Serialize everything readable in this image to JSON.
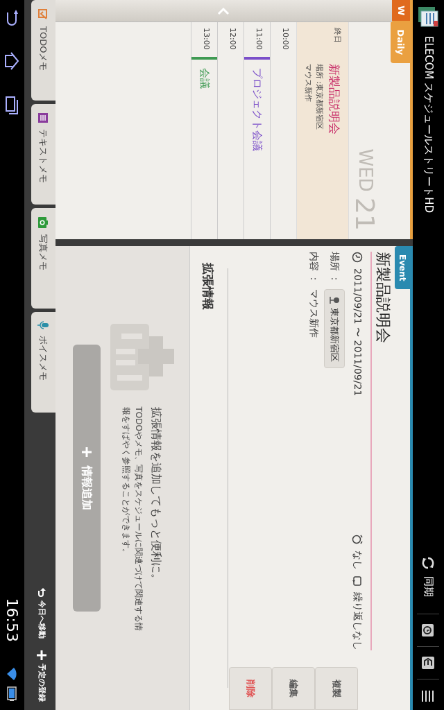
{
  "status_bar": {
    "app_title": "ELECOM スケジュールストリートHD",
    "sync_label": "同期"
  },
  "view_tabs": [
    {
      "label": "W",
      "selected": false
    },
    {
      "label": "Daily",
      "selected": true
    }
  ],
  "day": {
    "weekday": "WED",
    "date": "21"
  },
  "all_day": {
    "label": "終日",
    "title": "新製品説明会",
    "place": "場所 :東京都新宿区",
    "note": "マウス新作"
  },
  "timeline": [
    {
      "time": "10:00"
    },
    {
      "time": "11:00",
      "event": "プロジェクト会議",
      "color": "#7b4fc9"
    },
    {
      "time": "12:00"
    },
    {
      "time": "13:00",
      "event": "会議",
      "color": "#3f9a52"
    }
  ],
  "event": {
    "badge": "Event",
    "title": "新製品説明会",
    "period": "2011/09/21 〜 2011/09/21",
    "alarm": "なし",
    "repeat": "繰り返しなし",
    "place_label": "場所 ：",
    "place": "東京都新宿区",
    "content_label": "内容 ：",
    "content": "マウス新作"
  },
  "actions": [
    {
      "label": "複製",
      "kind": "normal"
    },
    {
      "label": "編集",
      "kind": "normal"
    },
    {
      "label": "削除",
      "kind": "danger"
    }
  ],
  "extension": {
    "heading": "拡張情報",
    "promo_title": "拡張情報を追加してもっと便利に。",
    "promo_text": "TODOやメモ、写真をスケジュールに関連づけて関連する情報をすばやく参照することができます。",
    "add_button": "情報追加"
  },
  "memo_tabs": [
    {
      "label": "TODOメモ",
      "kind": "todo"
    },
    {
      "label": "テキストメモ",
      "kind": "text"
    },
    {
      "label": "写真メモ",
      "kind": "photo"
    },
    {
      "label": "ボイスメモ",
      "kind": "voice"
    }
  ],
  "bottom_actions": [
    {
      "label": "今日へ移動",
      "kind": "today"
    },
    {
      "label": "予定の登録",
      "kind": "add"
    }
  ],
  "system_bar": {
    "time": "16:53"
  }
}
